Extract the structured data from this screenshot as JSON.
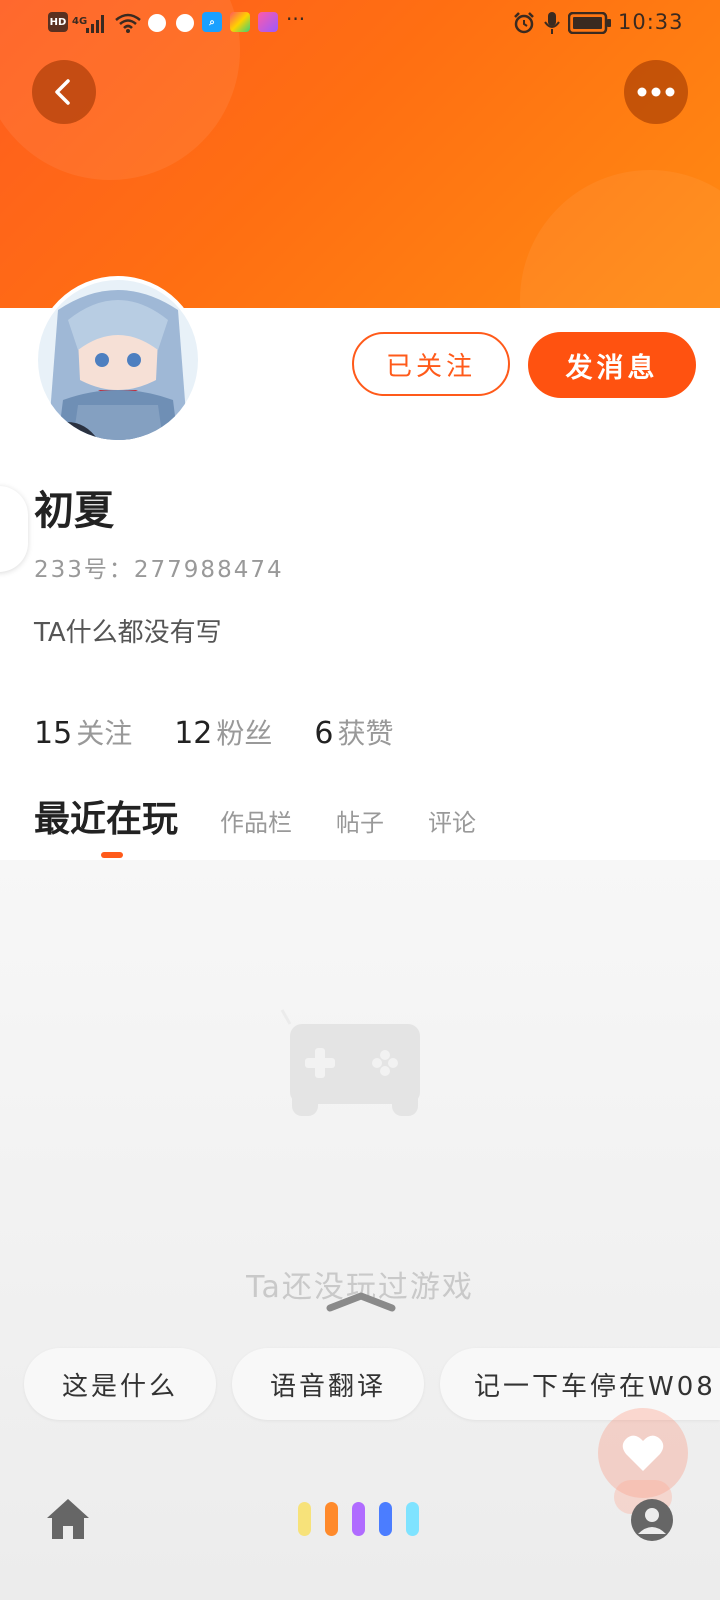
{
  "status_bar": {
    "hd": "HD",
    "signal": "4G",
    "time": "10:33",
    "more": "···"
  },
  "header": {
    "back_icon": "chevron-left-icon",
    "more_icon": "more-horizontal-icon"
  },
  "profile": {
    "name": "初夏",
    "uid": "233号：277988474",
    "bio": "TA什么都没有写",
    "followed_label": "已关注",
    "message_label": "发消息"
  },
  "stats": [
    {
      "num": "15",
      "label": "关注"
    },
    {
      "num": "12",
      "label": "粉丝"
    },
    {
      "num": "6",
      "label": "获赞"
    }
  ],
  "tabs": [
    {
      "label": "最近在玩",
      "active": true
    },
    {
      "label": "作品栏",
      "active": false
    },
    {
      "label": "帖子",
      "active": false
    },
    {
      "label": "评论",
      "active": false
    }
  ],
  "empty_state": {
    "icon": "gamepad-icon",
    "text": "Ta还没玩过游戏"
  },
  "assistant": {
    "chips": [
      "这是什么",
      "语音翻译",
      "记一下车停在W08"
    ],
    "home_icon": "home-icon",
    "profile_icon": "user-icon",
    "like_icon": "heart-icon",
    "colors": [
      "#f7e27a",
      "#ff8a2b",
      "#b06bff",
      "#4b7dff",
      "#7fe3ff"
    ]
  },
  "colors": {
    "accent": "#ff5a1a",
    "header_start": "#ff5d1f",
    "header_end": "#ff8b12"
  }
}
